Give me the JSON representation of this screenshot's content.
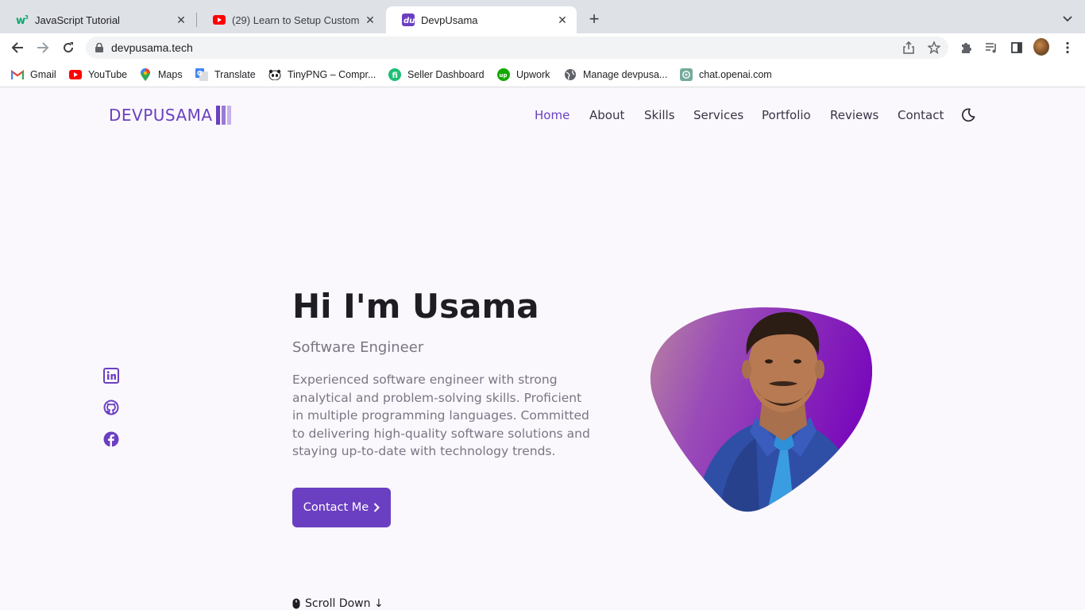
{
  "browser": {
    "tabs": [
      {
        "title": "JavaScript Tutorial",
        "active": false
      },
      {
        "title": "(29) Learn to Setup Custom Th",
        "active": false
      },
      {
        "title": "DevpUsama",
        "active": true
      }
    ],
    "url": "devpusama.tech",
    "bookmarks": [
      {
        "label": "Gmail",
        "icon": "gmail-icon"
      },
      {
        "label": "YouTube",
        "icon": "youtube-icon"
      },
      {
        "label": "Maps",
        "icon": "maps-icon"
      },
      {
        "label": "Translate",
        "icon": "translate-icon"
      },
      {
        "label": "TinyPNG – Compr...",
        "icon": "tinypng-icon"
      },
      {
        "label": "Seller Dashboard",
        "icon": "seller-icon"
      },
      {
        "label": "Upwork",
        "icon": "upwork-icon"
      },
      {
        "label": "Manage devpusa...",
        "icon": "globe-icon"
      },
      {
        "label": "chat.openai.com",
        "icon": "openai-icon"
      }
    ]
  },
  "site": {
    "logo": "DEVPUSAMA",
    "nav": [
      {
        "label": "Home",
        "active": true
      },
      {
        "label": "About"
      },
      {
        "label": "Skills"
      },
      {
        "label": "Services"
      },
      {
        "label": "Portfolio"
      },
      {
        "label": "Reviews"
      },
      {
        "label": "Contact"
      }
    ],
    "socials": [
      "linkedin-icon",
      "github-icon",
      "facebook-icon"
    ]
  },
  "hero": {
    "title": "Hi I'm Usama",
    "subtitle": "Software Engineer",
    "description": "Experienced software engineer with strong analytical and problem-solving skills. Proficient in multiple programming languages. Committed to delivering high-quality software solutions and staying up-to-date with technology trends.",
    "cta": "Contact Me",
    "scroll": "Scroll Down ↓"
  },
  "colors": {
    "accent": "#6b3fc1",
    "page_bg": "#faf8fc",
    "text_dark": "#1f1d24",
    "text_muted": "#7a7584"
  }
}
